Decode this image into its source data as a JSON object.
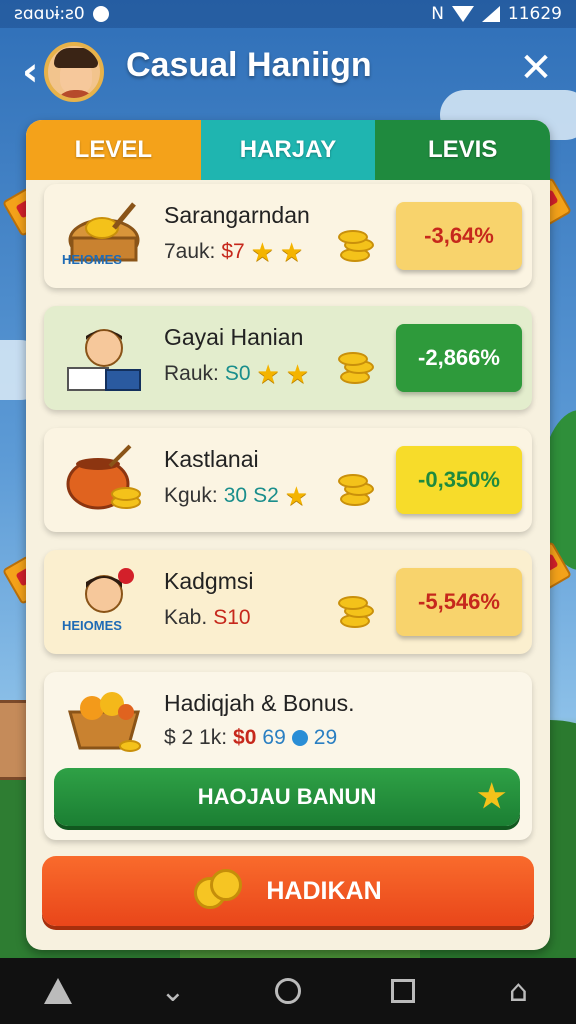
{
  "status_bar": {
    "left_text": "ƨɑɑʋɨ:ƨ0",
    "right_text": "11629"
  },
  "header": {
    "title": "Casual Haniign"
  },
  "tabs": [
    {
      "label": "LEVEL"
    },
    {
      "label": "HARJAY"
    },
    {
      "label": "LEVIS"
    }
  ],
  "cards": [
    {
      "name": "Sarangarndan",
      "sub_prefix": "7auk:",
      "price": "$7",
      "stars": 2,
      "percent": "-3,64%",
      "badge_style": "yellow",
      "illus_label": "HEIOMES"
    },
    {
      "name": "Gayai Hanian",
      "sub_prefix": "Rauk:",
      "price": "S0",
      "stars": 2,
      "percent": "-2,866%",
      "badge_style": "green"
    },
    {
      "name": "Kastlanai",
      "sub_prefix": "Kguk:",
      "price": "30",
      "price2": "S2",
      "stars": 1,
      "percent": "-0,350%",
      "badge_style": "lime"
    },
    {
      "name": "Kadgmsi",
      "sub_prefix": "Kab.",
      "price": "S10",
      "stars": 0,
      "percent": "-5,546%",
      "badge_style": "orange",
      "illus_label": "HEIOMES"
    }
  ],
  "bonus": {
    "name": "Hadiqjah & Bonus.",
    "sub_prefix": "$ 2 1k:",
    "price": "$0",
    "value_a": "69",
    "value_b": "29",
    "button_label": "HAOJAU BANUN"
  },
  "main_button": {
    "label": "HADIKAN"
  },
  "colors": {
    "tab_level": "#f4a21a",
    "tab_harjay": "#1fb5b0",
    "tab_levis": "#1f8a3e",
    "cta": "#f96b2c",
    "bonus_btn": "#2fa146"
  }
}
